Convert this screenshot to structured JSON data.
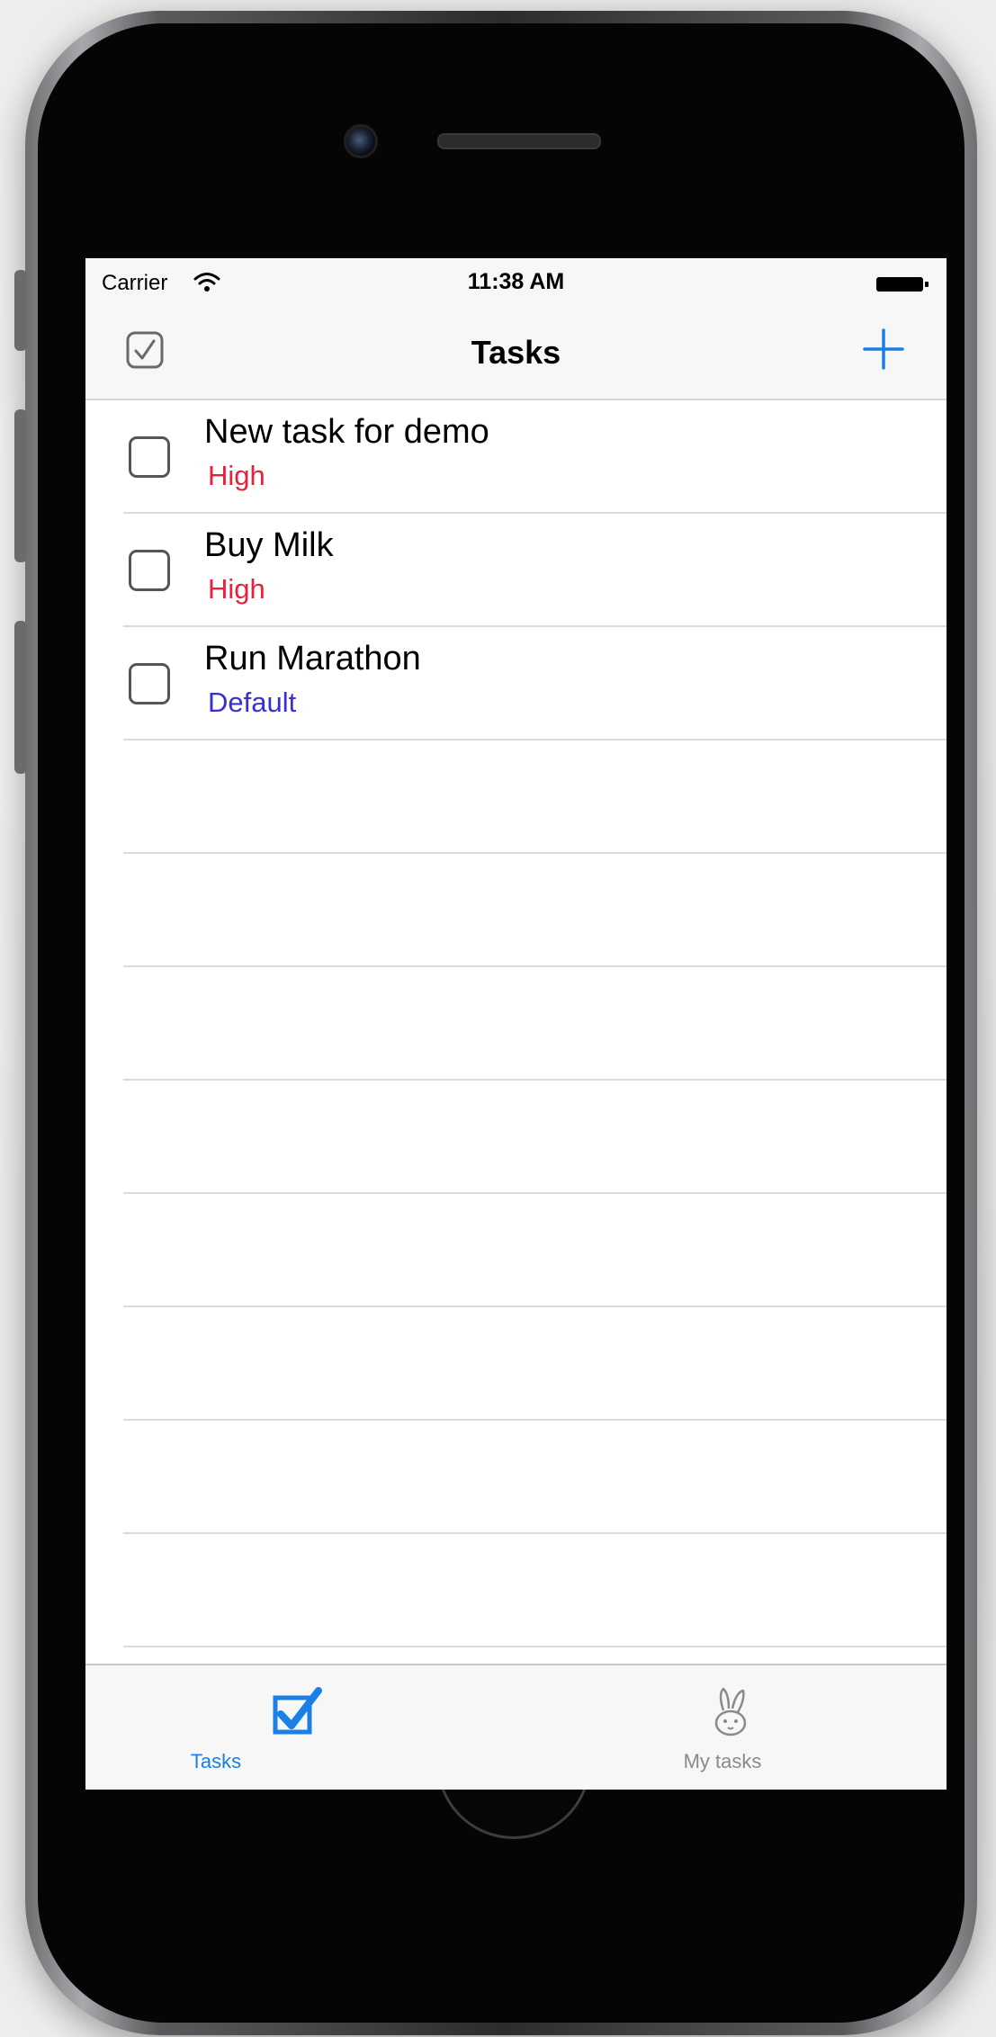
{
  "status_bar": {
    "carrier": "Carrier",
    "time": "11:38 AM"
  },
  "nav_bar": {
    "title": "Tasks"
  },
  "tasks": [
    {
      "title": "New task for demo",
      "priority": "High",
      "completed": false
    },
    {
      "title": "Buy Milk",
      "priority": "High",
      "completed": false
    },
    {
      "title": "Run Marathon",
      "priority": "Default",
      "completed": false
    }
  ],
  "tab_bar": {
    "items": [
      {
        "label": "Tasks",
        "icon": "checkbox-checked-icon",
        "selected": true
      },
      {
        "label": "My tasks",
        "icon": "bunny-icon",
        "selected": false
      }
    ]
  },
  "colors": {
    "accent": "#1a7fe6",
    "priority_high": "#e8213a",
    "priority_default": "#3a2fd4",
    "tab_inactive": "#8a8a8a"
  }
}
